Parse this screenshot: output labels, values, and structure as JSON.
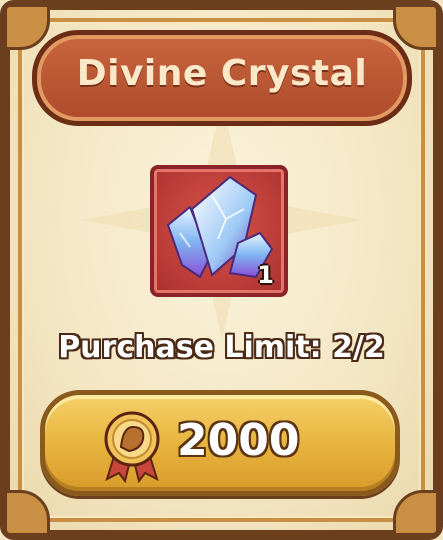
{
  "shop_item": {
    "title": "Divine Crystal",
    "icon": "crystal-icon",
    "quantity": "1",
    "purchase_limit": "Purchase Limit: 2/2",
    "price": {
      "currency_icon": "medal-icon",
      "amount": "2000"
    }
  },
  "colors": {
    "frame": "#6b3f1e",
    "banner": "#b8512f",
    "item_bg": "#c1423d",
    "button": "#e6b23c"
  }
}
